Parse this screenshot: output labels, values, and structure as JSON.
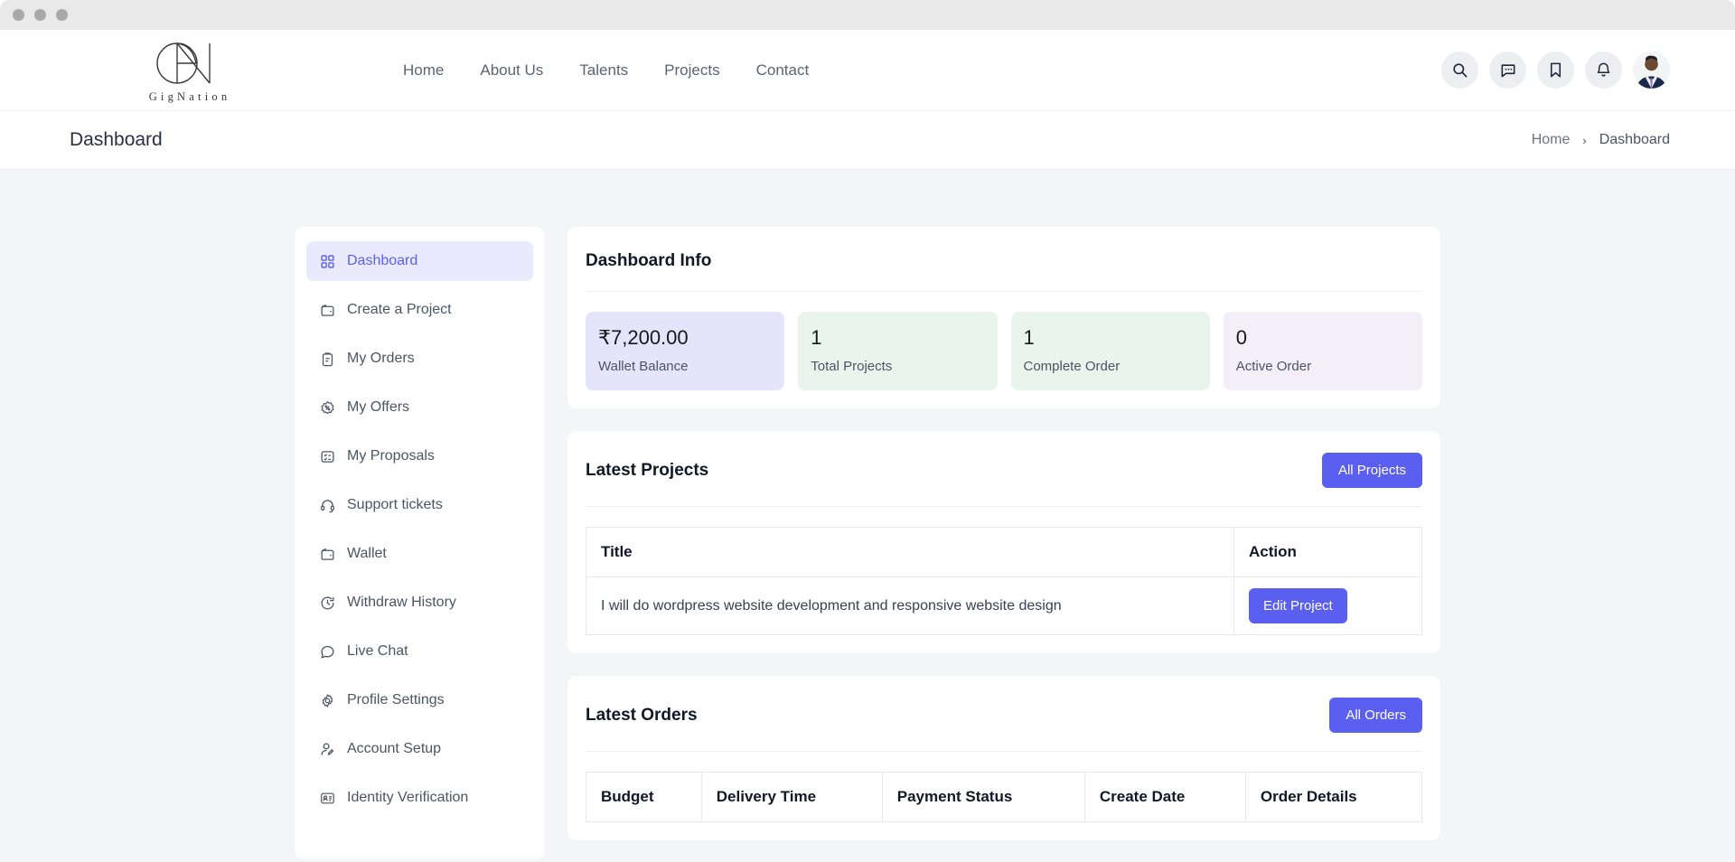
{
  "window": {
    "dots": 3
  },
  "brand": {
    "name": "GigNation",
    "logo_icon": "gignation-monogram-icon"
  },
  "nav": {
    "items": [
      {
        "label": "Home"
      },
      {
        "label": "About Us"
      },
      {
        "label": "Talents"
      },
      {
        "label": "Projects"
      },
      {
        "label": "Contact"
      }
    ]
  },
  "header_actions": {
    "search_icon": "search-icon",
    "messages_icon": "chat-bubble-icon",
    "bookmark_icon": "bookmark-icon",
    "notifications_icon": "bell-icon",
    "avatar": "user-avatar"
  },
  "breadcrumb": {
    "page_title": "Dashboard",
    "home": "Home",
    "separator": "›",
    "current": "Dashboard"
  },
  "sidebar": {
    "items": [
      {
        "label": "Dashboard",
        "icon": "grid-icon",
        "active": true
      },
      {
        "label": "Create a Project",
        "icon": "wallet-icon",
        "active": false
      },
      {
        "label": "My Orders",
        "icon": "clipboard-icon",
        "active": false
      },
      {
        "label": "My Offers",
        "icon": "discount-badge-icon",
        "active": false
      },
      {
        "label": "My Proposals",
        "icon": "checklist-icon",
        "active": false
      },
      {
        "label": "Support tickets",
        "icon": "headset-icon",
        "active": false
      },
      {
        "label": "Wallet",
        "icon": "wallet-icon",
        "active": false
      },
      {
        "label": "Withdraw History",
        "icon": "clock-history-icon",
        "active": false
      },
      {
        "label": "Live Chat",
        "icon": "chat-icon",
        "active": false
      },
      {
        "label": "Profile Settings",
        "icon": "gear-icon",
        "active": false
      },
      {
        "label": "Account Setup",
        "icon": "user-edit-icon",
        "active": false
      },
      {
        "label": "Identity Verification",
        "icon": "id-card-icon",
        "active": false
      }
    ]
  },
  "dashboard_info": {
    "title": "Dashboard Info",
    "stats": [
      {
        "value": "₹7,200.00",
        "label": "Wallet Balance",
        "tone": "violet"
      },
      {
        "value": "1",
        "label": "Total Projects",
        "tone": "green"
      },
      {
        "value": "1",
        "label": "Complete Order",
        "tone": "green"
      },
      {
        "value": "0",
        "label": "Active Order",
        "tone": "pink"
      }
    ]
  },
  "latest_projects": {
    "title": "Latest Projects",
    "action_label": "All Projects",
    "columns": [
      "Title",
      "Action"
    ],
    "rows": [
      {
        "title": "I will do wordpress website development and responsive website design",
        "action_label": "Edit Project"
      }
    ]
  },
  "latest_orders": {
    "title": "Latest Orders",
    "action_label": "All Orders",
    "columns": [
      "Budget",
      "Delivery Time",
      "Payment Status",
      "Create Date",
      "Order Details"
    ]
  },
  "colors": {
    "accent": "#5b5ff0",
    "page_bg": "#f4f5f7",
    "card_bg": "#ffffff",
    "stat_violet": "#e6e4fb",
    "stat_green": "#e9f5ec",
    "stat_pink": "#f4eef8"
  }
}
